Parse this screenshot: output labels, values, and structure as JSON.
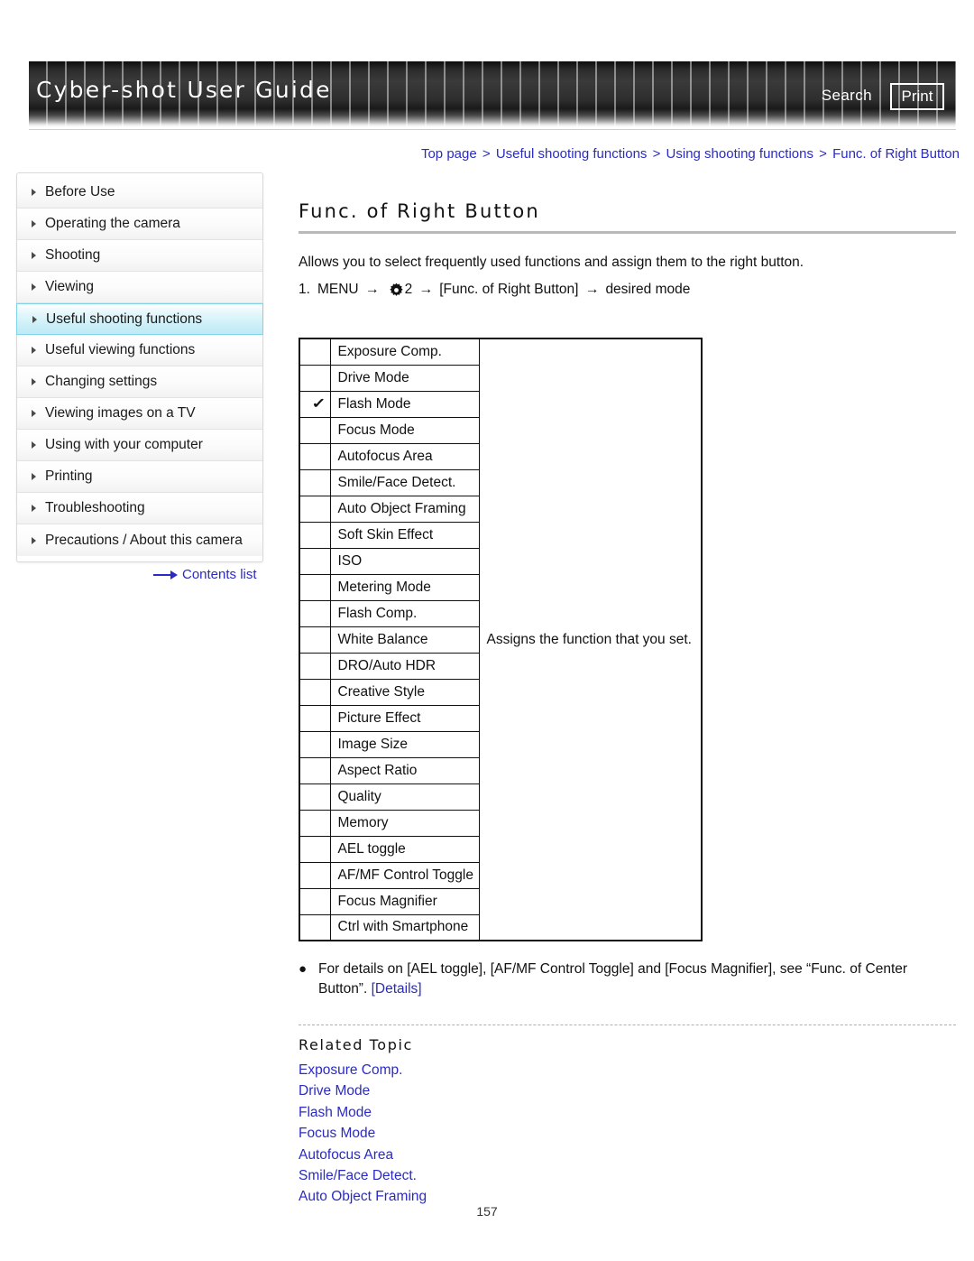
{
  "header": {
    "title": "Cyber-shot User Guide",
    "search_label": "Search",
    "print_label": "Print"
  },
  "breadcrumb": {
    "separator": ">",
    "items": [
      "Top page",
      "Useful shooting functions",
      "Using shooting functions",
      "Func. of Right Button"
    ]
  },
  "sidebar": {
    "items": [
      {
        "label": "Before Use",
        "active": false
      },
      {
        "label": "Operating the camera",
        "active": false
      },
      {
        "label": "Shooting",
        "active": false
      },
      {
        "label": "Viewing",
        "active": false
      },
      {
        "label": "Useful shooting functions",
        "active": true
      },
      {
        "label": "Useful viewing functions",
        "active": false
      },
      {
        "label": "Changing settings",
        "active": false
      },
      {
        "label": "Viewing images on a TV",
        "active": false
      },
      {
        "label": "Using with your computer",
        "active": false
      },
      {
        "label": "Printing",
        "active": false
      },
      {
        "label": "Troubleshooting",
        "active": false
      },
      {
        "label": "Precautions / About this camera",
        "active": false
      }
    ],
    "contents_list_label": "Contents list"
  },
  "main": {
    "page_title": "Func. of Right Button",
    "intro": "Allows you to select frequently used functions and assign them to the right button.",
    "step": {
      "number": "1.",
      "menu_label": "MENU",
      "arrow": "→",
      "gear_icon": "gear-icon",
      "gear_number": "2",
      "bracket_item": "[Func. of Right Button]",
      "target": "desired mode"
    },
    "table": {
      "description": "Assigns the function that you set.",
      "check_glyph": "✓",
      "rows": [
        {
          "checked": false,
          "label": "Exposure Comp."
        },
        {
          "checked": false,
          "label": "Drive Mode"
        },
        {
          "checked": true,
          "label": "Flash Mode"
        },
        {
          "checked": false,
          "label": "Focus Mode"
        },
        {
          "checked": false,
          "label": "Autofocus Area"
        },
        {
          "checked": false,
          "label": "Smile/Face Detect."
        },
        {
          "checked": false,
          "label": "Auto Object Framing"
        },
        {
          "checked": false,
          "label": "Soft Skin Effect"
        },
        {
          "checked": false,
          "label": "ISO"
        },
        {
          "checked": false,
          "label": "Metering Mode"
        },
        {
          "checked": false,
          "label": "Flash Comp."
        },
        {
          "checked": false,
          "label": "White Balance"
        },
        {
          "checked": false,
          "label": "DRO/Auto HDR"
        },
        {
          "checked": false,
          "label": "Creative Style"
        },
        {
          "checked": false,
          "label": "Picture Effect"
        },
        {
          "checked": false,
          "label": "Image Size"
        },
        {
          "checked": false,
          "label": "Aspect Ratio"
        },
        {
          "checked": false,
          "label": "Quality"
        },
        {
          "checked": false,
          "label": "Memory"
        },
        {
          "checked": false,
          "label": "AEL toggle"
        },
        {
          "checked": false,
          "label": "AF/MF Control Toggle"
        },
        {
          "checked": false,
          "label": "Focus Magnifier"
        },
        {
          "checked": false,
          "label": "Ctrl with Smartphone"
        }
      ]
    },
    "note": {
      "bullet": "●",
      "text": "For details on [AEL toggle], [AF/MF Control Toggle] and [Focus Magnifier], see “Func. of Center Button”. ",
      "link_label": "[Details]"
    },
    "related_topic": {
      "heading": "Related Topic",
      "links": [
        "Exposure Comp.",
        "Drive Mode",
        "Flash Mode",
        "Focus Mode",
        "Autofocus Area",
        "Smile/Face Detect.",
        "Auto Object Framing"
      ]
    }
  },
  "page_number": "157",
  "colors": {
    "link": "#2b2bc4",
    "active_sidebar": "#c9eef7",
    "header_dark": "#1a1a1a"
  }
}
